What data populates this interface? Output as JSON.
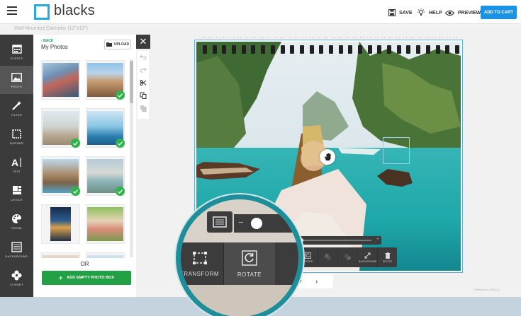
{
  "topbar": {
    "logo_text": "blacks",
    "save_label": "SAVE",
    "help_label": "HELP",
    "preview_label": "PREVIEW",
    "add_to_cart_label": "ADD TO CART"
  },
  "document": {
    "title": "Wall-Mounted Calendar (12\"x12\")"
  },
  "rail": {
    "items": [
      {
        "label": "EVENTS",
        "icon": "calendar-icon"
      },
      {
        "label": "PHOTO",
        "icon": "image-icon",
        "active": true
      },
      {
        "label": "FILTER",
        "icon": "magic-wand-icon"
      },
      {
        "label": "BORDER",
        "icon": "border-icon"
      },
      {
        "label": "TEXT",
        "icon": "text-icon"
      },
      {
        "label": "LAYOUT",
        "icon": "layout-icon"
      },
      {
        "label": "THEME",
        "icon": "palette-icon"
      },
      {
        "label": "BACKGROUND",
        "icon": "background-icon"
      },
      {
        "label": "CLIPART",
        "icon": "clipart-icon"
      }
    ]
  },
  "panel": {
    "back_label": "BACK",
    "title": "My Photos",
    "upload_label": "UPLOAD",
    "or_label": "OR",
    "add_empty_label": "ADD EMPTY PHOTO BOX",
    "thumbnails": [
      {
        "name": "Canal city",
        "used": false
      },
      {
        "name": "Castle",
        "used": true
      },
      {
        "name": "Desert",
        "used": true
      },
      {
        "name": "Surfer",
        "used": true
      },
      {
        "name": "Giraffe",
        "used": true
      },
      {
        "name": "Boat beach",
        "used": true
      },
      {
        "name": "Night couple",
        "used": false
      },
      {
        "name": "Family",
        "used": false
      },
      {
        "name": "Street",
        "used": false
      },
      {
        "name": "Kids",
        "used": false
      }
    ]
  },
  "photo_toolbar": {
    "items": [
      {
        "label": "ROTATE"
      },
      {
        "label": ""
      },
      {
        "label": ""
      },
      {
        "label": "BACKGROUND"
      },
      {
        "label": "DELETE"
      }
    ]
  },
  "magnifier": {
    "transform_label": "TRANSFORM",
    "rotate_label": "ROTATE"
  },
  "copyright": "© Meteor Inc. 2023 v1.0"
}
